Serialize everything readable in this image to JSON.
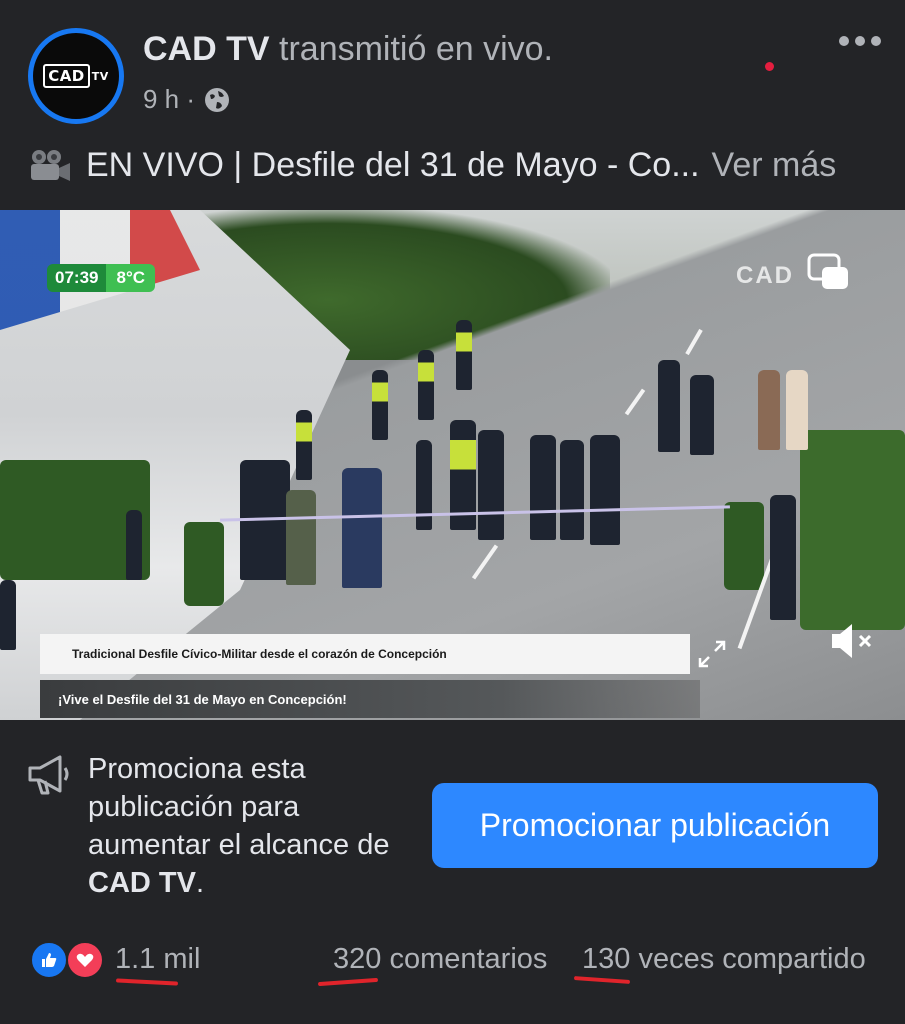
{
  "post": {
    "page_name": "CAD TV",
    "action": "transmitió en vivo.",
    "time": "9 h ·",
    "avatar_logo": "CAD",
    "avatar_logo_suffix": "TV",
    "audience_icon": "globe-icon",
    "caption": "EN VIVO | Desfile del 31 de Mayo - Co...",
    "caption_icon": "movie-camera-icon",
    "see_more": "Ver más"
  },
  "video": {
    "clock_time": "07:39",
    "clock_temp": "8°C",
    "watermark": "CAD",
    "lower_third_1": "Tradicional Desfile Cívico-Militar desde el corazón de Concepción",
    "lower_third_2": "¡Vive el Desfile del 31 de Mayo en Concepción!"
  },
  "promo": {
    "text_line1": "Promociona esta",
    "text_line2": "publicación para",
    "text_line3": "aumentar el alcance de",
    "text_bold": "CAD TV",
    "text_end": ".",
    "button_label": "Promocionar publicación"
  },
  "stats": {
    "reactions": "1.1 mil",
    "comments_count": "320",
    "comments_label": " comentarios",
    "shares_count": "130",
    "shares_label": " veces compartido"
  },
  "colors": {
    "background": "#232427",
    "primary_button": "#2d88ff",
    "like": "#1877f2",
    "love": "#f33e58",
    "annotation": "#e0242b"
  }
}
